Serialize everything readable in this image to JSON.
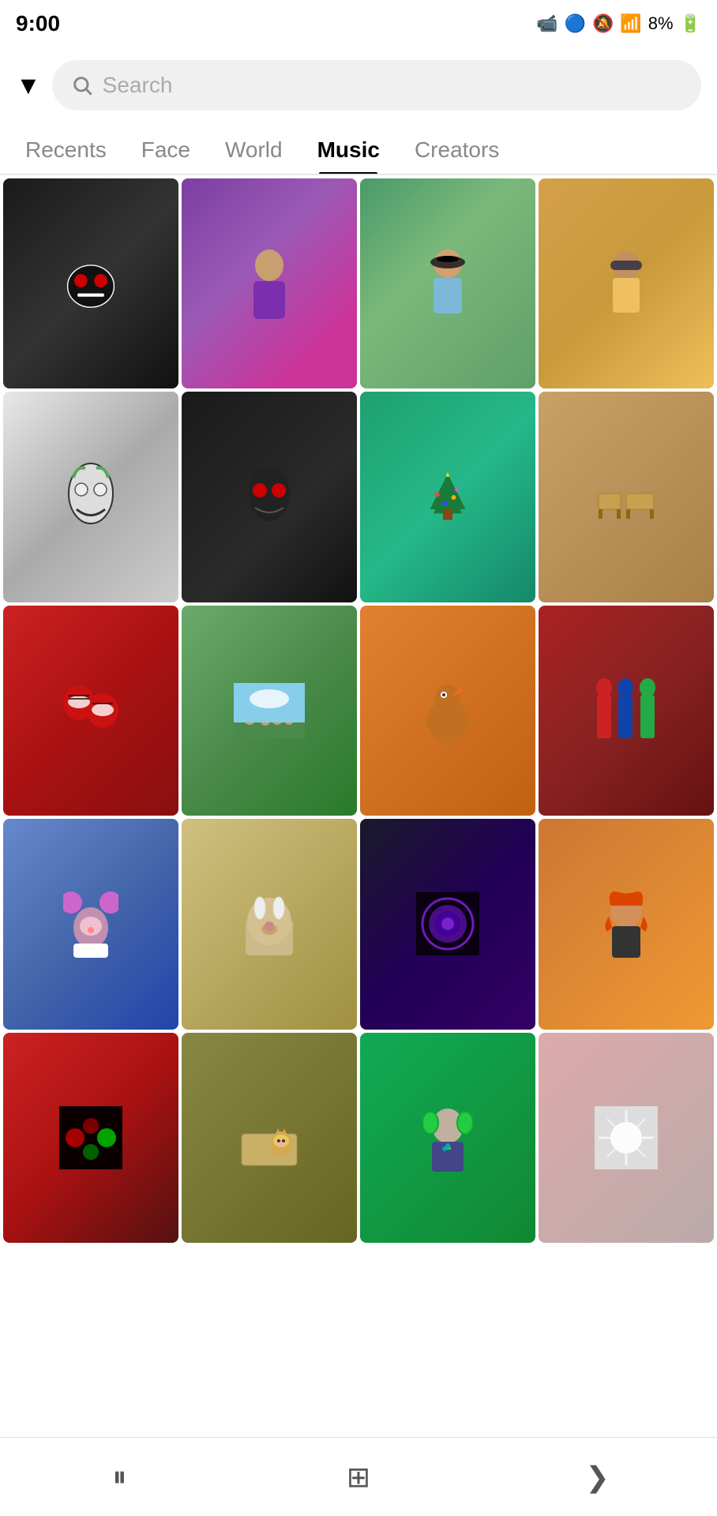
{
  "statusBar": {
    "time": "9:00",
    "battery": "8%",
    "icons": "📹"
  },
  "search": {
    "placeholder": "Search",
    "dropdownLabel": "▼"
  },
  "tabs": [
    {
      "id": "recents",
      "label": "Recents",
      "active": false
    },
    {
      "id": "face",
      "label": "Face",
      "active": false
    },
    {
      "id": "world",
      "label": "World",
      "active": false
    },
    {
      "id": "music",
      "label": "Music",
      "active": true
    },
    {
      "id": "creators",
      "label": "Creators",
      "active": false
    }
  ],
  "grid": {
    "items": [
      {
        "id": 1,
        "alt": "Troll face filter"
      },
      {
        "id": 2,
        "alt": "Purple outfit selfie"
      },
      {
        "id": 3,
        "alt": "Sunglasses selfie outdoors"
      },
      {
        "id": 4,
        "alt": "Sunglasses selfie colorful"
      },
      {
        "id": 5,
        "alt": "Joker face art"
      },
      {
        "id": 6,
        "alt": "Dark horror face"
      },
      {
        "id": 7,
        "alt": "Christmas tree"
      },
      {
        "id": 8,
        "alt": "Backyard furniture"
      },
      {
        "id": 9,
        "alt": "Spider-Man masks selfie"
      },
      {
        "id": 10,
        "alt": "Tiny animals on grass"
      },
      {
        "id": 11,
        "alt": "Dancing turkey filter"
      },
      {
        "id": 12,
        "alt": "Superhero figures"
      },
      {
        "id": 13,
        "alt": "Mouse ears girl"
      },
      {
        "id": 14,
        "alt": "Bunny dog filter"
      },
      {
        "id": 19,
        "alt": "Purple moon filter"
      },
      {
        "id": 20,
        "alt": "Redhead woman"
      },
      {
        "id": 21,
        "alt": "Red neon filter"
      },
      {
        "id": 22,
        "alt": "Cat on furniture"
      },
      {
        "id": 23,
        "alt": "Gamer headset man"
      },
      {
        "id": 24,
        "alt": "Light burst effect"
      }
    ]
  },
  "bottomNav": {
    "pause": "⏸",
    "grid": "⊞",
    "back": "❯"
  }
}
